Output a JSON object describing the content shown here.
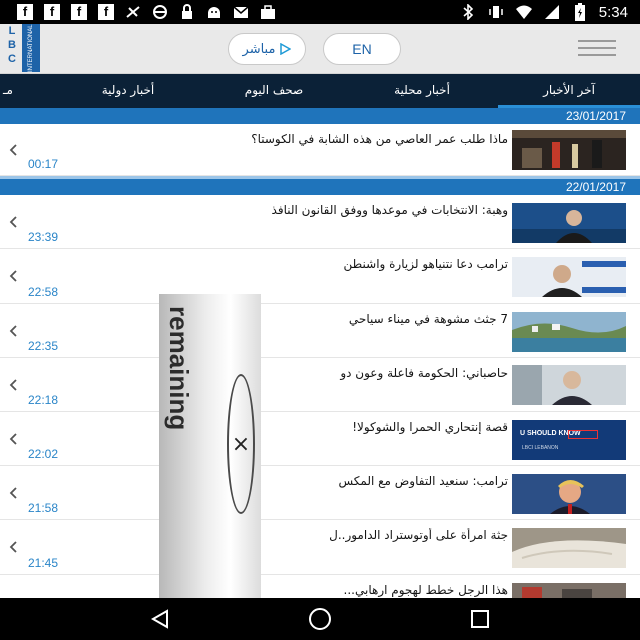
{
  "status_bar": {
    "time": "5:34",
    "left_icons": [
      "facebook-icon",
      "facebook-icon",
      "facebook-icon",
      "facebook-icon",
      "no-data-icon",
      "vpn-icon",
      "lock-icon",
      "android-icon",
      "mail-icon",
      "briefcase-icon"
    ],
    "right_icons": [
      "bluetooth-icon",
      "vibrate-icon",
      "wifi-icon",
      "signal-icon",
      "battery-icon"
    ]
  },
  "header": {
    "logo_text": "LBC",
    "logo_sub": "INTERNATIONAL",
    "live_label": "مباشر",
    "lang_label": "EN"
  },
  "tabs": [
    {
      "label": "آخر الأخبار",
      "active": true
    },
    {
      "label": "أخبار محلية",
      "active": false
    },
    {
      "label": "صحف اليوم",
      "active": false
    },
    {
      "label": "أخبار دولية",
      "active": false
    },
    {
      "label": "مـ",
      "active": false
    }
  ],
  "news": {
    "dates": [
      "23/01/2017",
      "22/01/2017"
    ],
    "items": [
      {
        "title": "ماذا طلب عمر العاصي من هذه الشابة في الكوستا؟",
        "time": "00:17",
        "thumb": "night-street"
      },
      {
        "title": "وهبة: الانتخابات في موعدها ووفق القانون النافذ",
        "time": "23:39",
        "thumb": "portrait-blue"
      },
      {
        "title": "ترامب دعا نتنياهو لزيارة واشنطن",
        "time": "22:58",
        "thumb": "portrait-flag"
      },
      {
        "title": "7 جثث مشوهة في ميناء سياحي",
        "time": "22:35",
        "thumb": "coast"
      },
      {
        "title": "حاصباني: الحكومة فاعلة وعون دو",
        "time": "22:18",
        "thumb": "portrait-office"
      },
      {
        "title": "قصة إنتحاري الحمرا والشوكولا!",
        "time": "22:02",
        "thumb": "u-should-know",
        "thumb_text": "U SHOULD KNOW",
        "thumb_sub": "LBCI LEBANON"
      },
      {
        "title": "ترامب: سنعيد التفاوض مع المكس",
        "time": "21:58",
        "thumb": "trump"
      },
      {
        "title": "جثة امرأة على أوتوستراد الدامور..ل",
        "time": "21:45",
        "thumb": "sheet"
      },
      {
        "title": "هذا الرجل خطط لهجوم ارهابي...",
        "time": "",
        "thumb": "crowd"
      }
    ]
  },
  "overlay": {
    "text": "remaining",
    "close_glyph": "×"
  },
  "colors": {
    "tab_bar": "#0b2137",
    "date_bar": "#1f74bb",
    "accent": "#2a85c8",
    "header_bg": "#e9e9e9"
  }
}
